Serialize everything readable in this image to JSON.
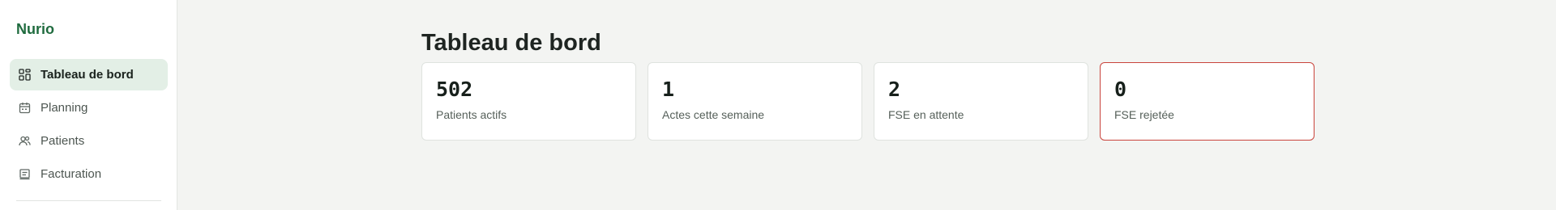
{
  "app": {
    "name": "Nurio"
  },
  "sidebar": {
    "items": [
      {
        "label": "Tableau de bord",
        "icon": "dashboard-grid-icon",
        "active": true
      },
      {
        "label": "Planning",
        "icon": "calendar-icon",
        "active": false
      },
      {
        "label": "Patients",
        "icon": "users-icon",
        "active": false
      },
      {
        "label": "Facturation",
        "icon": "receipt-icon",
        "active": false
      }
    ]
  },
  "main": {
    "title": "Tableau de bord",
    "cards": [
      {
        "value": "502",
        "label": "Patients actifs",
        "status": "normal"
      },
      {
        "value": "1",
        "label": "Actes cette semaine",
        "status": "normal"
      },
      {
        "value": "2",
        "label": "FSE en attente",
        "status": "normal"
      },
      {
        "value": "0",
        "label": "FSE rejetée",
        "status": "danger"
      }
    ]
  },
  "colors": {
    "brand": "#1f6b3e",
    "active_background": "#e3efe6",
    "danger_border": "#c9443c",
    "page_background": "#f3f4f2"
  }
}
